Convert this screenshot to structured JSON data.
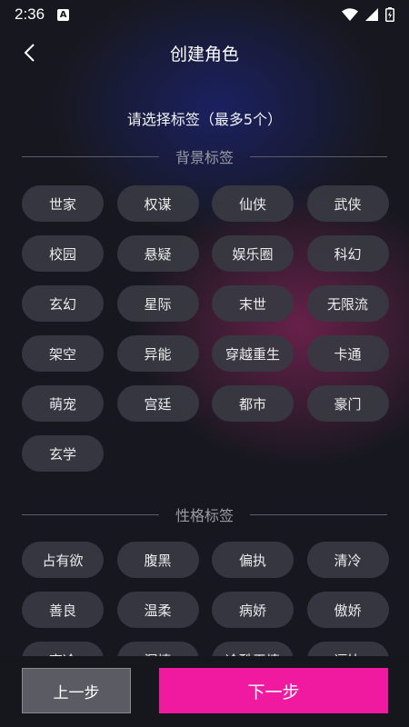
{
  "status_bar": {
    "time": "2:36",
    "notification_glyph": "A",
    "icons": [
      "wifi-icon",
      "signal-icon",
      "battery-icon"
    ]
  },
  "header": {
    "back_icon": "chevron-left-icon",
    "title": "创建角色"
  },
  "instruction": "请选择标签（最多5个）",
  "sections": [
    {
      "label": "背景标签",
      "tags": [
        "世家",
        "权谋",
        "仙侠",
        "武侠",
        "校园",
        "悬疑",
        "娱乐圈",
        "科幻",
        "玄幻",
        "星际",
        "末世",
        "无限流",
        "架空",
        "异能",
        "穿越重生",
        "卡通",
        "萌宠",
        "宫廷",
        "都市",
        "豪门",
        "玄学"
      ]
    },
    {
      "label": "性格标签",
      "tags": [
        "占有欲",
        "腹黑",
        "偏执",
        "清冷",
        "善良",
        "温柔",
        "病娇",
        "傲娇",
        "高冷",
        "深情",
        "冷酷无情",
        "逗比"
      ]
    }
  ],
  "footer": {
    "prev_label": "上一步",
    "next_label": "下一步"
  },
  "colors": {
    "accent": "#f01aa0",
    "background": "#17181f",
    "tag_bg": "#383942"
  }
}
